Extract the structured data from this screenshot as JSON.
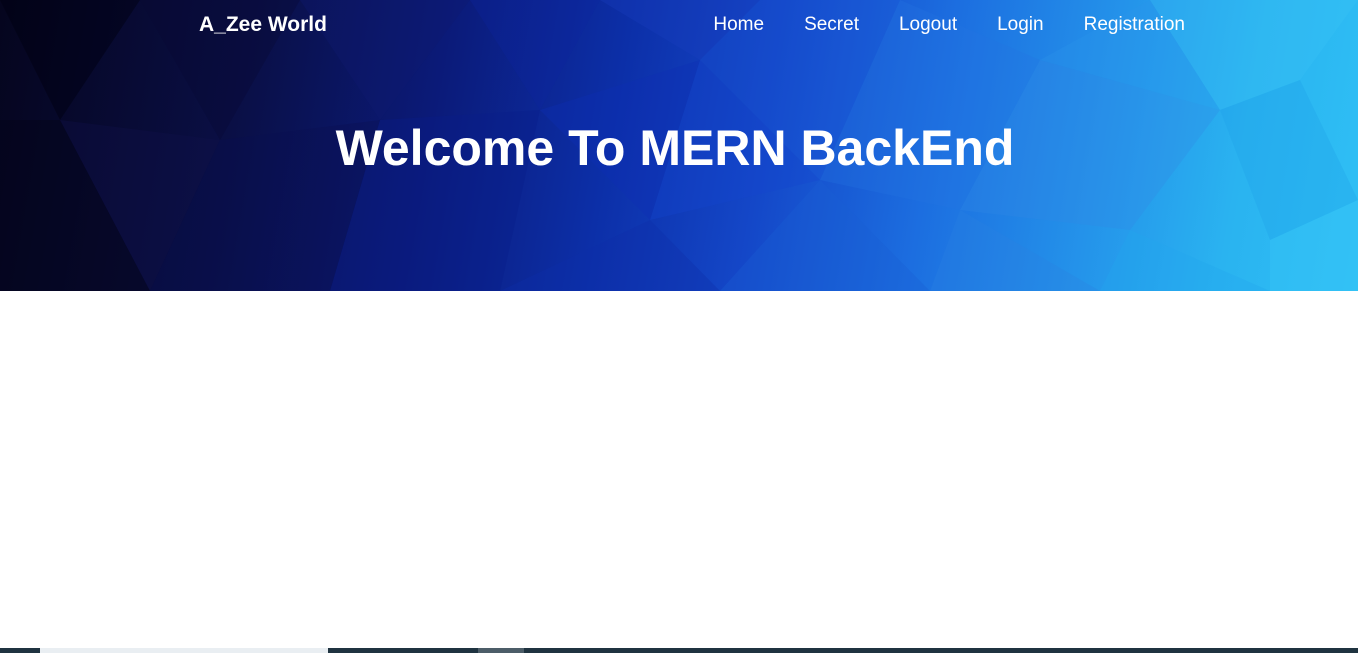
{
  "navbar": {
    "brand": "A_Zee World",
    "links": [
      {
        "label": "Home"
      },
      {
        "label": "Secret"
      },
      {
        "label": "Logout"
      },
      {
        "label": "Login"
      },
      {
        "label": "Registration"
      }
    ]
  },
  "hero": {
    "title": "Welcome To MERN BackEnd"
  },
  "colors": {
    "hero_dark": "#05051e",
    "hero_blue": "#0c2fa8",
    "hero_light": "#2fc0f5",
    "text": "#ffffff",
    "page_background": "#ffffff"
  }
}
